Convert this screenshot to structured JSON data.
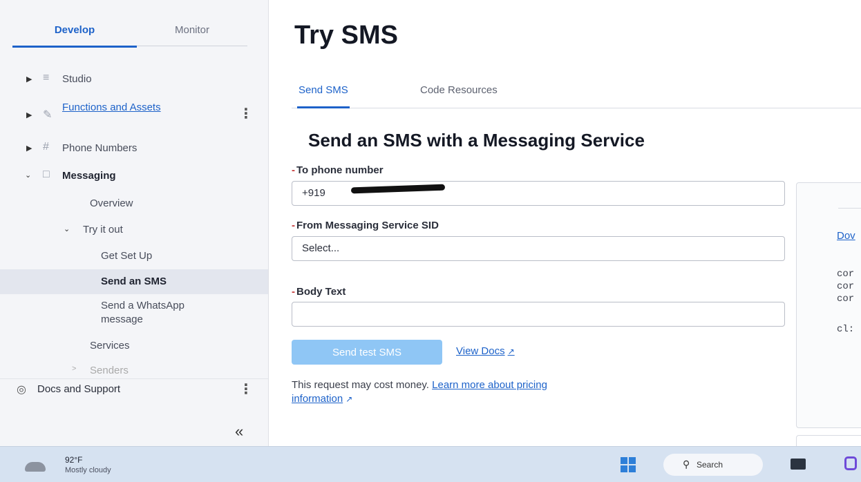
{
  "sidebar": {
    "tabs": {
      "develop": "Develop",
      "monitor": "Monitor"
    },
    "items": {
      "studio": "Studio",
      "functions": "Functions and Assets",
      "phone_numbers": "Phone Numbers",
      "messaging": "Messaging",
      "overview": "Overview",
      "try_it_out": "Try it out",
      "get_set_up": "Get Set Up",
      "send_sms": "Send an SMS",
      "send_whatsapp_line1": "Send a WhatsApp",
      "send_whatsapp_line2": "message",
      "services": "Services",
      "senders": "Senders",
      "docs_support": "Docs and Support"
    },
    "collapse": "«"
  },
  "main": {
    "title": "Try SMS",
    "tabs": {
      "send_sms": "Send SMS",
      "code_resources": "Code Resources"
    },
    "section_title": "Send an SMS with a Messaging Service",
    "form": {
      "to_label": "To phone number",
      "to_value": "+919",
      "from_label": "From Messaging Service SID",
      "from_value": "Select...",
      "body_label": "Body Text",
      "body_value": "",
      "send_button": "Send test SMS",
      "view_docs": "View Docs",
      "cost_text": "This request may cost money.",
      "cost_link_1": "Learn more about pricing",
      "cost_link_2": "information"
    },
    "code_panel": {
      "link": "Dov",
      "lines": [
        "cor",
        "cor",
        "cor",
        "cl:"
      ]
    }
  },
  "taskbar": {
    "temperature": "92°F",
    "condition": "Mostly cloudy",
    "search": "Search"
  },
  "colors": {
    "accent": "#1d62c9",
    "send_button_disabled": "#8fc6f5",
    "sidebar_bg": "#f4f5f8"
  }
}
